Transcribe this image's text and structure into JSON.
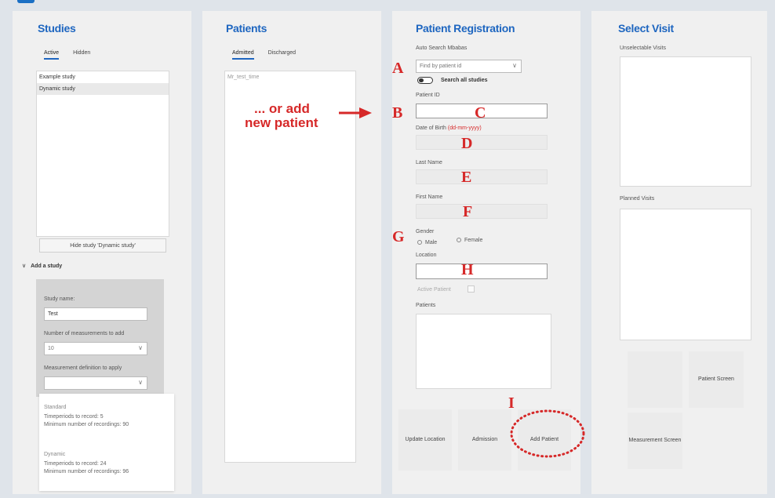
{
  "studies": {
    "title": "Studies",
    "tabs": [
      "Active",
      "Hidden"
    ],
    "items": [
      "Example study",
      "Dynamic study"
    ],
    "hide_button": "Hide study 'Dynamic study'",
    "add_study": {
      "toggle_label": "Add a study",
      "name_label": "Study name:",
      "name_value": "Test",
      "measurements_label": "Number of measurements to add",
      "measurements_value": "10",
      "definition_label": "Measurement definition to apply",
      "definition_value": ""
    },
    "definitions": [
      {
        "name": "Standard",
        "lines": [
          "Timeperiods to record: 5",
          "Minimum number of recordings: 90"
        ]
      },
      {
        "name": "Dynamic",
        "lines": [
          "Timeperiods to record: 24",
          "Minimum number of recordings: 96"
        ]
      }
    ]
  },
  "patients": {
    "title": "Patients",
    "tabs": [
      "Admitted",
      "Discharged"
    ],
    "items": [
      "Mr_test_time"
    ]
  },
  "registration": {
    "title": "Patient Registration",
    "auto_search_label": "Auto Search Mbabas",
    "find_placeholder": "Find by patient id",
    "search_all": "Search all studies",
    "patient_id_label": "Patient ID",
    "dob_label": "Date of Birth",
    "dob_hint": "(dd-mm-yyyy)",
    "last_name_label": "Last Name",
    "first_name_label": "First Name",
    "gender_label": "Gender",
    "gender_options": [
      "Male",
      "Female"
    ],
    "location_label": "Location",
    "active_patient_label": "Active Patient",
    "patients_label": "Patients",
    "buttons": {
      "update_location": "Update Location",
      "admission": "Admission",
      "add_patient": "Add Patient"
    }
  },
  "visit": {
    "title": "Select Visit",
    "unselectable_label": "Unselectable Visits",
    "planned_label": "Planned Visits",
    "patient_screen": "Patient Screen",
    "measurement_screen": "Measurement Screen"
  },
  "annotations": {
    "letters": {
      "A": "A",
      "B": "B",
      "C": "C",
      "D": "D",
      "E": "E",
      "F": "F",
      "G": "G",
      "H": "H",
      "I": "I"
    },
    "note_line1": "... or add",
    "note_line2": "new patient",
    "color": "#d62828"
  },
  "colors": {
    "accent": "#1e66c0",
    "annotation": "#d62828"
  }
}
